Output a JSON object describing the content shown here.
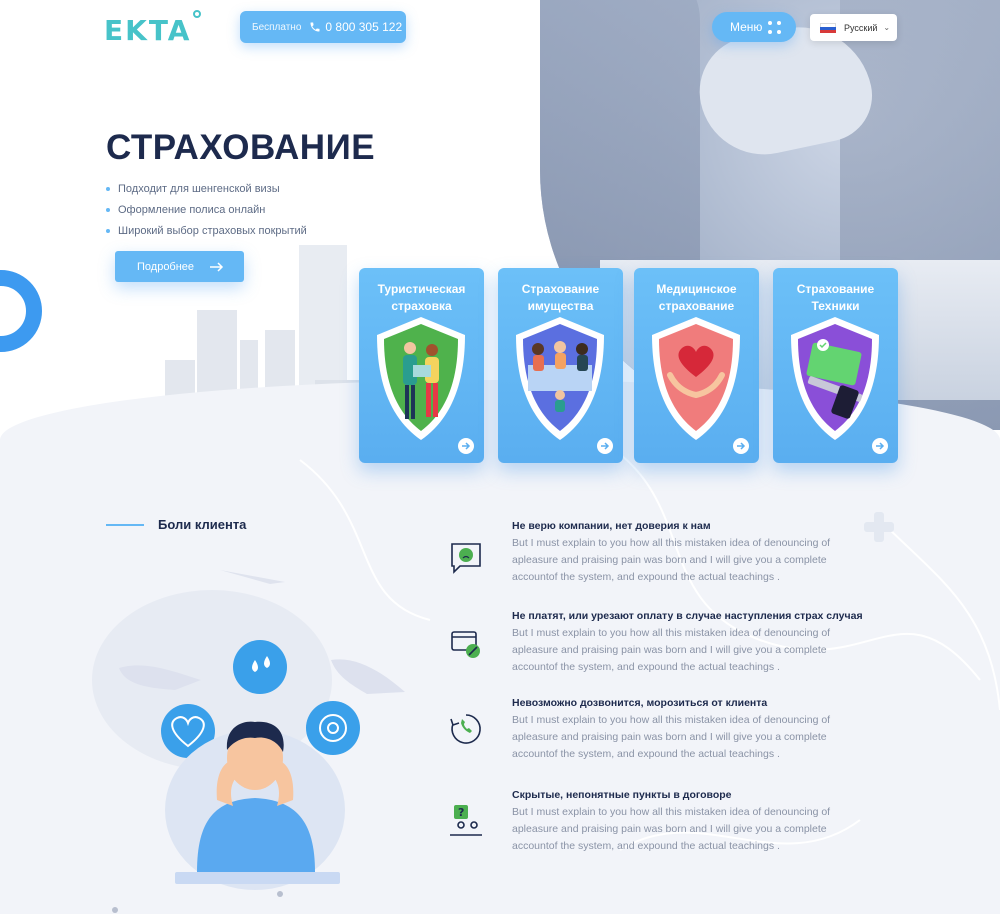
{
  "header": {
    "logo": "EKTA",
    "phone": {
      "free_label": "Бесплатно",
      "number": "0 800 305 122"
    },
    "menu_label": "Меню",
    "language": "Русский"
  },
  "hero": {
    "title": "СТРАХОВАНИЕ",
    "bullets": [
      "Подходит для шенгенской визы",
      "Оформление полиса онлайн",
      "Широкий выбор страховых покрытий"
    ],
    "cta": "Подробнее"
  },
  "cards": [
    {
      "title": "Туристическая страховка",
      "shield_color": "#4fb24c",
      "icon": "travelers-icon"
    },
    {
      "title": "Страхование имущества",
      "shield_color": "#5b6fe0",
      "icon": "family-home-icon"
    },
    {
      "title": "Медицинское страхование",
      "shield_color": "#f07c7c",
      "icon": "heart-hands-icon"
    },
    {
      "title": "Страхование Техники",
      "shield_color": "#8a4fd8",
      "icon": "devices-icon"
    }
  ],
  "pains": {
    "title": "Боли клиента",
    "items": [
      {
        "title": "Не верю компании, нет доверия к нам",
        "text": "But I must explain to you how all this mistaken idea of denouncing of apleasure and praising pain was born and I will give you a complete accountof the system, and expound the actual teachings .",
        "icon": "chat-sad-face-icon"
      },
      {
        "title": "Не платят, или урезают оплату в случае наступления страх случая",
        "text": "But I must explain to you how all this mistaken idea of denouncing of apleasure and praising pain was born and I will give you a complete accountof the system, and expound the actual teachings .",
        "icon": "card-blocked-icon"
      },
      {
        "title": "Невозможно дозвонится, морозиться от клиента",
        "text": "But I must explain to you how all this mistaken idea of denouncing of apleasure and praising pain was born and I will give you a complete accountof the system, and expound the actual teachings .",
        "icon": "phone-callback-icon"
      },
      {
        "title": "Скрытые, непонятные пункты в договоре",
        "text": "But I must explain to you how all this mistaken idea of denouncing of apleasure and praising pain was born and I will give you a complete accountof the system, and expound the actual teachings .",
        "icon": "question-person-icon"
      }
    ]
  },
  "colors": {
    "accent": "#65b8f5",
    "dark": "#1d2a4d",
    "logo": "#47c3c9"
  }
}
